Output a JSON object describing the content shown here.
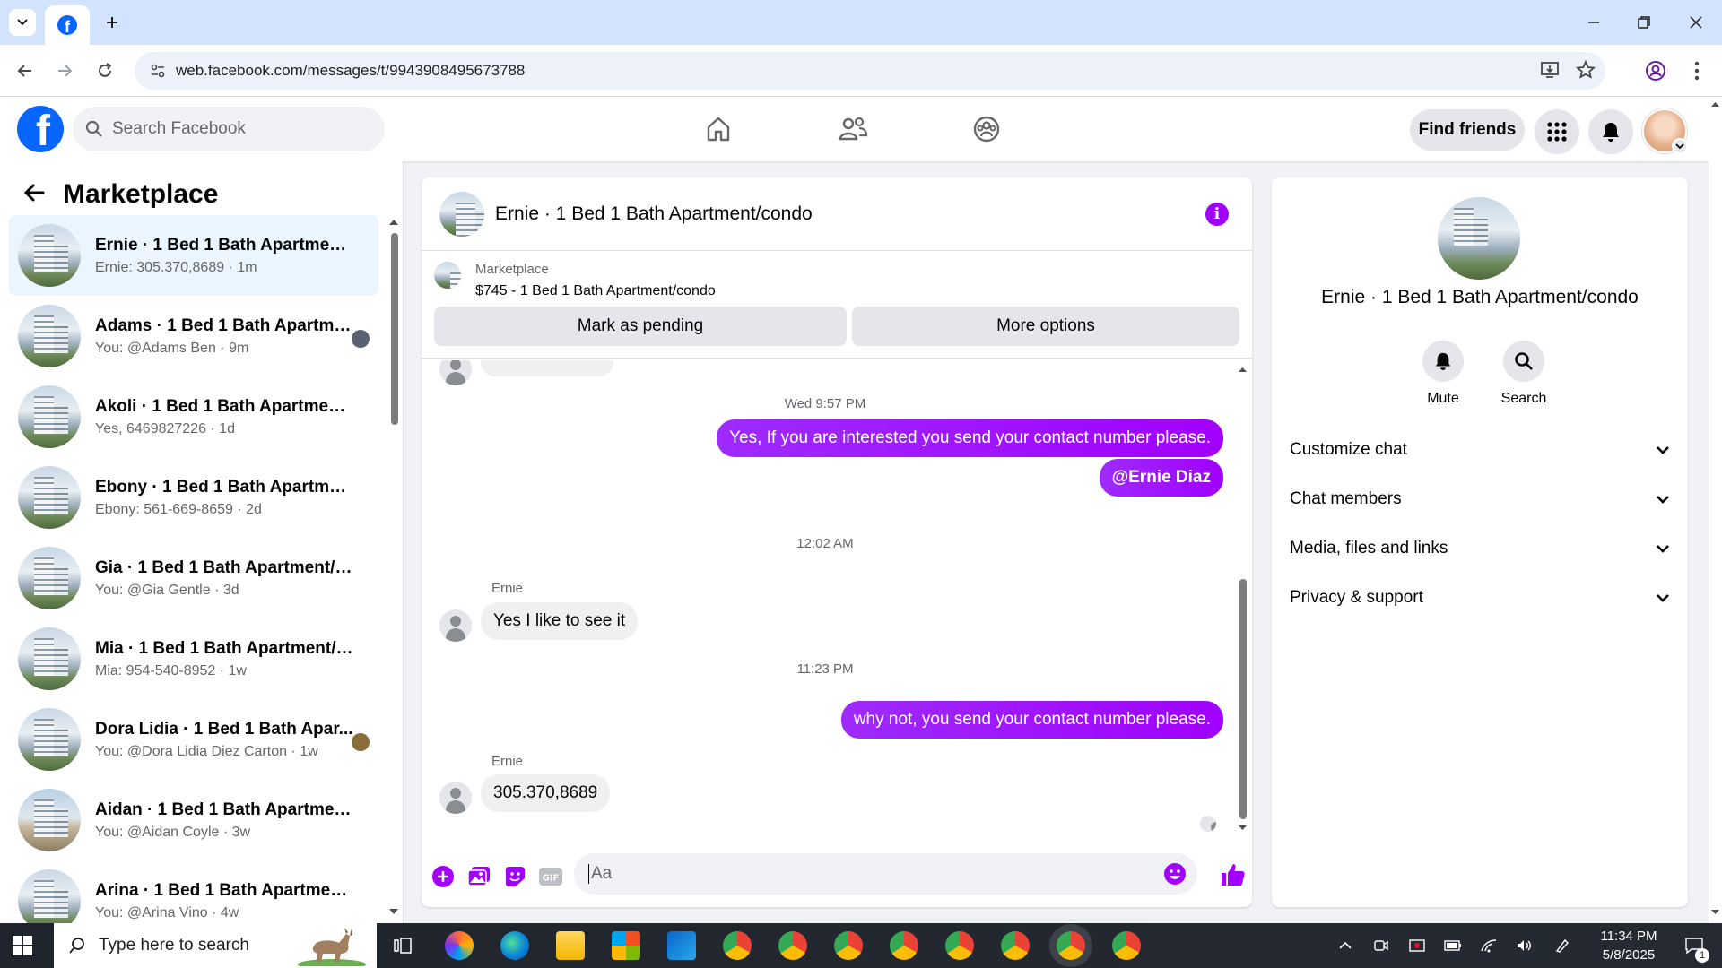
{
  "browser": {
    "url": "web.facebook.com/messages/t/9943908495673788"
  },
  "fb_header": {
    "search_placeholder": "Search Facebook",
    "find_friends": "Find friends"
  },
  "left": {
    "title": "Marketplace",
    "conversations": [
      {
        "name": "Ernie · 1 Bed 1 Bath Apartment/c...",
        "preview": "Ernie: 305.370,8689 · 1m"
      },
      {
        "name": "Adams · 1 Bed 1 Bath Apartme...",
        "preview": "You: @Adams Ben · 9m"
      },
      {
        "name": "Akoli · 1 Bed 1 Bath Apartment/c...",
        "preview": "Yes, 6469827226 · 1d"
      },
      {
        "name": "Ebony · 1 Bed 1 Bath Apartment/...",
        "preview": "Ebony: 561-669-8659 · 2d"
      },
      {
        "name": "Gia · 1 Bed 1 Bath Apartment/co...",
        "preview": "You: @Gia Gentle · 3d"
      },
      {
        "name": "Mia · 1 Bed 1 Bath Apartment/co...",
        "preview": "Mia: 954-540-8952 · 1w"
      },
      {
        "name": "Dora Lidia · 1 Bed 1 Bath Apar...",
        "preview": "You: @Dora Lidia Diez Carton · 1w"
      },
      {
        "name": "Aidan · 1 Bed 1 Bath Apartment/...",
        "preview": "You: @Aidan Coyle · 3w"
      },
      {
        "name": "Arina · 1 Bed 1 Bath Apartment/c...",
        "preview": "You: @Arina Vino · 4w"
      }
    ]
  },
  "chat": {
    "title": "Ernie · 1 Bed 1 Bath Apartment/condo",
    "listing_label": "Marketplace",
    "listing_price": "$745 - 1 Bed 1 Bath Apartment/condo",
    "mark_pending": "Mark as pending",
    "more_options": "More options",
    "messages": {
      "ts1": "Wed 9:57 PM",
      "out1": "Yes, If you are interested you send your contact number please.",
      "out2": "@Ernie Diaz",
      "ts2": "12:02 AM",
      "sender1": "Ernie",
      "in1": "Yes I like to see it",
      "ts3": "11:23 PM",
      "out3": "why not, you send your contact number please.",
      "sender2": "Ernie",
      "in2": "305.370,8689"
    },
    "composer_placeholder": "Aa"
  },
  "right": {
    "title": "Ernie · 1 Bed 1 Bath Apartment/condo",
    "mute": "Mute",
    "search": "Search",
    "accordions": [
      "Customize chat",
      "Chat members",
      "Media, files and links",
      "Privacy & support"
    ]
  },
  "taskbar": {
    "search_placeholder": "Type here to search",
    "time": "11:34 PM",
    "date": "5/8/2025",
    "notifications": "1"
  },
  "colors": {
    "fb_blue": "#0866ff",
    "message_purple": "#a100ff",
    "active_conv": "#ebf5ff"
  }
}
